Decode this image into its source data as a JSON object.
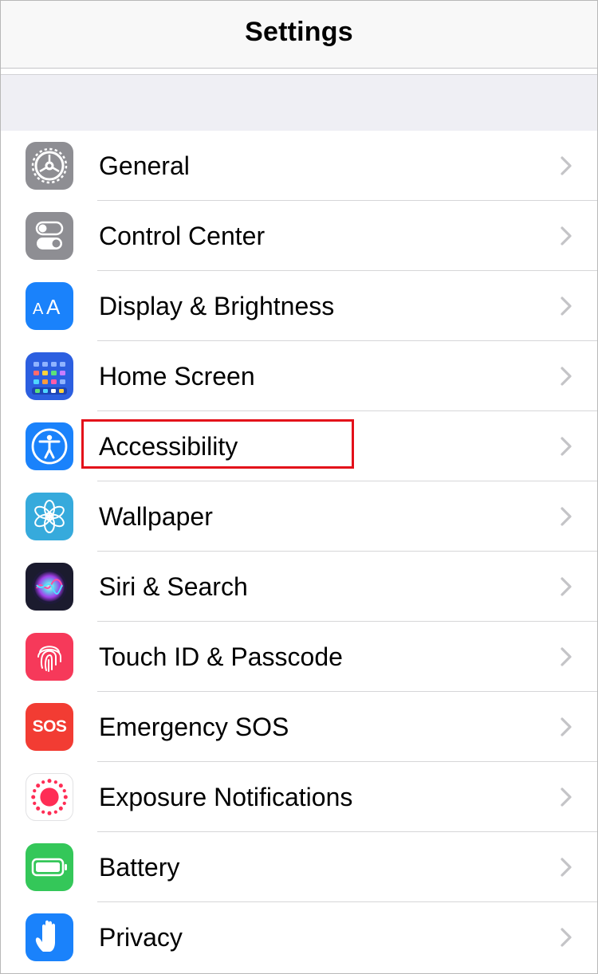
{
  "header": {
    "title": "Settings"
  },
  "settings": {
    "items": [
      {
        "label": "General",
        "icon": "gear-icon",
        "icon_bg": "#8e8e93"
      },
      {
        "label": "Control Center",
        "icon": "toggles-icon",
        "icon_bg": "#8e8e93"
      },
      {
        "label": "Display & Brightness",
        "icon": "text-size-icon",
        "icon_bg": "#1a82fb"
      },
      {
        "label": "Home Screen",
        "icon": "app-grid-icon",
        "icon_bg": "#2c5fe0"
      },
      {
        "label": "Accessibility",
        "icon": "accessibility-icon",
        "icon_bg": "#1a82fb"
      },
      {
        "label": "Wallpaper",
        "icon": "flower-icon",
        "icon_bg": "#36aadc"
      },
      {
        "label": "Siri & Search",
        "icon": "siri-icon",
        "icon_bg": "#1b1b2e"
      },
      {
        "label": "Touch ID & Passcode",
        "icon": "fingerprint-icon",
        "icon_bg": "#f6395a"
      },
      {
        "label": "Emergency SOS",
        "icon": "sos-icon",
        "icon_bg": "#f23c33",
        "icon_text": "SOS"
      },
      {
        "label": "Exposure Notifications",
        "icon": "exposure-icon",
        "icon_bg": "#ffffff"
      },
      {
        "label": "Battery",
        "icon": "battery-icon",
        "icon_bg": "#34c759"
      },
      {
        "label": "Privacy",
        "icon": "hand-icon",
        "icon_bg": "#1a82fb"
      }
    ]
  },
  "highlight": {
    "target": "Accessibility",
    "color": "#e3101a"
  },
  "colors": {
    "chevron": "#c4c4c7",
    "separator": "#d6d6d8",
    "group_bg": "#efeff4"
  }
}
